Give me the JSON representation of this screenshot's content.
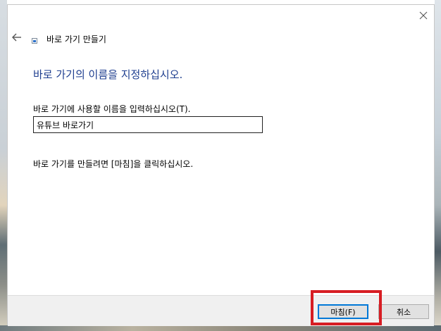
{
  "window": {
    "title": "바로 가기 만들기",
    "icons": {
      "back": "back-arrow-icon",
      "close": "close-icon",
      "app": "shortcut-icon"
    }
  },
  "main": {
    "heading": "바로 가기의 이름을 지정하십시오.",
    "name_label": "바로 가기에 사용할 이름을 입력하십시오(T).",
    "name_value": "유튜브 바로가기",
    "hint": "바로 가기를 만들려면 [마침]을 클릭하십시오."
  },
  "buttons": {
    "finish_label": "마침(F)",
    "cancel_label": "취소"
  },
  "colors": {
    "heading": "#1e3e8f",
    "highlight": "#d71d23",
    "focus_border": "#0078d7"
  }
}
